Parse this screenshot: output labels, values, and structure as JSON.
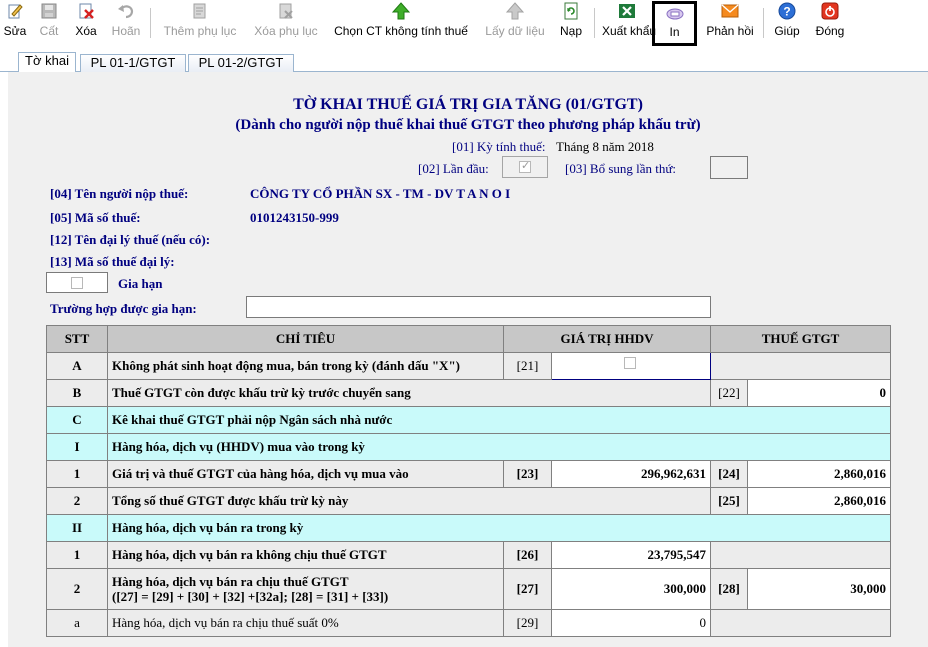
{
  "toolbar": {
    "buttons": [
      {
        "label": "Sửa",
        "icon": "edit-icon"
      },
      {
        "label": "Cất",
        "icon": "save-icon"
      },
      {
        "label": "Xóa",
        "icon": "delete-icon"
      },
      {
        "label": "Hoãn",
        "icon": "undo-icon"
      },
      {
        "label": "Thêm phụ lục",
        "icon": "add-appendix-icon"
      },
      {
        "label": "Xóa phụ lục",
        "icon": "delete-appendix-icon"
      },
      {
        "label": "Chọn CT không tính thuế",
        "icon": "green-up-arrow-icon"
      },
      {
        "label": "Lấy dữ liệu",
        "icon": "gray-up-arrow-icon"
      },
      {
        "label": "Nạp",
        "icon": "load-icon"
      },
      {
        "label": "Xuất khẩu",
        "icon": "excel-icon"
      },
      {
        "label": "In",
        "icon": "print-icon"
      },
      {
        "label": "Phản hồi",
        "icon": "mail-icon"
      },
      {
        "label": "Giúp",
        "icon": "help-icon"
      },
      {
        "label": "Đóng",
        "icon": "close-icon"
      }
    ]
  },
  "tabs": [
    "Tờ khai",
    "PL 01-1/GTGT",
    "PL 01-2/GTGT"
  ],
  "form": {
    "title": "TỜ KHAI THUẾ GIÁ TRỊ GIA TĂNG (01/GTGT)",
    "subtitle": "(Dành cho người nộp thuế khai thuế GTGT theo phương pháp khấu trừ)",
    "period_label": "[01] Kỳ tính thuế:",
    "period_value": "Tháng 8 năm 2018",
    "first_label": "[02] Lần đầu:",
    "supplement_label": "[03] Bổ sung lần thứ:",
    "taxpayer_label": "[04] Tên người nộp thuế:",
    "taxpayer_value": "CÔNG TY CỔ PHẦN SX - TM - DV T A N O I",
    "taxcode_label": "[05] Mã số thuế:",
    "taxcode_value": "0101243150-999",
    "agent_label": "[12] Tên đại lý thuế (nếu có):",
    "agent_code_label": "[13] Mã số thuế đại lý:",
    "extension_label": "Gia hạn",
    "extension_case_label": "Trường hợp được gia hạn:"
  },
  "table": {
    "headers": {
      "stt": "STT",
      "chi_tieu": "CHỈ TIÊU",
      "hhdv": "GIÁ TRỊ HHDV",
      "gtgt": "THUẾ GTGT"
    },
    "rows": [
      {
        "stt": "A",
        "label": "Không phát sinh hoạt động mua, bán trong kỳ (đánh dấu \"X\")",
        "c1": "[21]"
      },
      {
        "stt": "B",
        "label": "Thuế GTGT còn được khấu trừ kỳ trước chuyển sang",
        "c2": "[22]",
        "v2": "0"
      },
      {
        "stt": "C",
        "label": "Kê khai thuế GTGT phải nộp Ngân sách nhà nước"
      },
      {
        "stt": "I",
        "label": "Hàng hóa, dịch vụ (HHDV) mua vào trong kỳ"
      },
      {
        "stt": "1",
        "label": "Giá trị và thuế GTGT của hàng hóa, dịch vụ mua vào",
        "c1": "[23]",
        "v1": "296,962,631",
        "c2": "[24]",
        "v2": "2,860,016"
      },
      {
        "stt": "2",
        "label": "Tổng số thuế GTGT  được khấu trừ kỳ này",
        "c2": "[25]",
        "v2": "2,860,016"
      },
      {
        "stt": "II",
        "label": "Hàng hóa, dịch vụ bán ra trong kỳ"
      },
      {
        "stt": "1",
        "label": "Hàng hóa, dịch vụ bán ra không chịu thuế GTGT",
        "c1": "[26]",
        "v1": "23,795,547"
      },
      {
        "stt": "2",
        "label": "Hàng hóa, dịch vụ bán ra chịu thuế GTGT",
        "label2": "([27] = [29] + [30] + [32] +[32a]; [28] = [31] + [33])",
        "c1": "[27]",
        "v1": "300,000",
        "c2": "[28]",
        "v2": "30,000"
      },
      {
        "stt": "a",
        "label": "Hàng hóa, dịch vụ bán ra chịu thuế suất 0%",
        "c1": "[29]",
        "v1": "0"
      }
    ]
  }
}
